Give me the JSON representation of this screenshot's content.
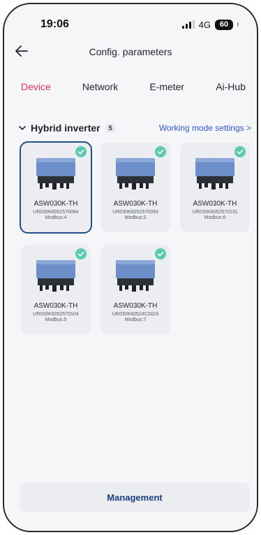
{
  "status_bar": {
    "time": "19:06",
    "network": "4G",
    "battery": "60"
  },
  "header": {
    "title": "Config. parameters",
    "back_icon": "arrow-left-icon"
  },
  "tabs": [
    {
      "label": "Device",
      "active": true
    },
    {
      "label": "Network",
      "active": false
    },
    {
      "label": "E-meter",
      "active": false
    },
    {
      "label": "Ai-Hub",
      "active": false
    }
  ],
  "section": {
    "title": "Hybrid inverter",
    "count": "5",
    "link": "Working mode settings >"
  },
  "devices": [
    {
      "model": "ASW030K-TH",
      "sn": "UR030K6052570084",
      "modbus": "Modbus:4",
      "selected": true
    },
    {
      "model": "ASW030K-TH",
      "sn": "UR030K6052570093",
      "modbus": "Modbus:3",
      "selected": false
    },
    {
      "model": "ASW030K-TH",
      "sn": "UR030K6052570131",
      "modbus": "Modbus:6",
      "selected": false
    },
    {
      "model": "ASW030K-TH",
      "sn": "UR030K6052570104",
      "modbus": "Modbus:5",
      "selected": false
    },
    {
      "model": "ASW030K-TH",
      "sn": "UR030K60524C0024",
      "modbus": "Modbus:7",
      "selected": false
    }
  ],
  "footer": {
    "management_label": "Management"
  },
  "colors": {
    "active_tab": "#e8305f",
    "link": "#2f55d4",
    "check": "#5cc9b0",
    "selected_border": "#1f4f86",
    "button_text": "#1b3f80"
  }
}
